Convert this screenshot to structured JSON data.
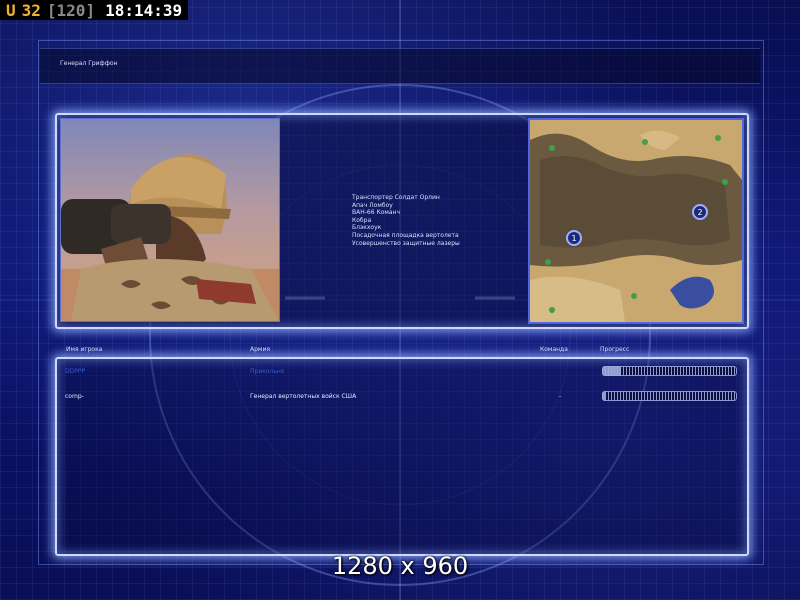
{
  "hud": {
    "prefix": "U",
    "fps": "32",
    "fps_cap": "[120]",
    "time": "18:14:39"
  },
  "general_name": "Генерал Гриффон",
  "units": [
    "Транспортер Солдат Орлин",
    "Апач Ломбоу",
    "ВАН-66 Команч",
    "Кобра",
    "Блэкхоук",
    "Посадочная площадка вертолета",
    "Усовершенство защитные лазеры"
  ],
  "columns": {
    "player": "Имя игрока",
    "army": "Армия",
    "team": "Команда",
    "progress": "Прогресс"
  },
  "players": [
    {
      "name": "DDPPP",
      "army": "Прикольно",
      "team": "",
      "progress": 0.14,
      "color": "#3b5bd8"
    },
    {
      "name": "comp-",
      "army": "Генерал вертолетных войск США",
      "team": "-",
      "progress": 0.02,
      "color": "#e8ecff"
    }
  ],
  "minimap": {
    "start_positions": [
      "1",
      "2"
    ]
  },
  "resolution_text": "1280 x 960",
  "colors": {
    "hud_accent": "#f2b233",
    "panel_glow": "#cfd9ff",
    "background": "#0b1470"
  }
}
